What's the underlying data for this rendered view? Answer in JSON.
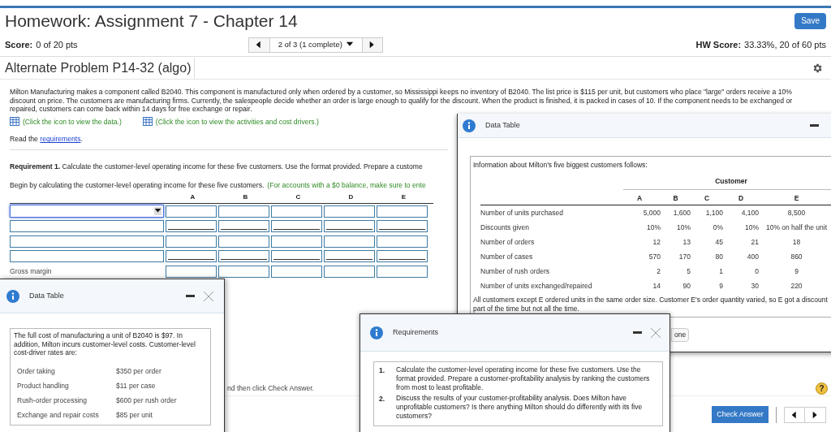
{
  "header": {
    "title": "Homework: Assignment 7 - Chapter 14",
    "save_button": "Save"
  },
  "score_bar": {
    "score_label": "Score:",
    "score_value": "0 of 20 pts",
    "nav_position": "2 of 3 (1 complete)",
    "hw_score_label": "HW Score:",
    "hw_score_value": "33.33%, 20 of 60 pts"
  },
  "problem": {
    "title": "Alternate Problem P14-32 (algo)",
    "description": "Milton Manufacturing makes a component called B2040. This component is manufactured only when ordered by a customer, so Mississippi keeps no inventory of B2040. The list price is $115 per unit, but customers who place \"large\" orders receive a 10% discount on price. The customers are manufacturing firms. Currently, the salespeople decide whether an order is large enough to qualify for the discount. When the product is finished, it is packed in cases of 10. If the component needs to be exchanged or repaired, customers can come back within 14 days for free exchange or repair.",
    "links": [
      "(Click the icon to view the data.)",
      "(Click the icon to view the activities and cost drivers.)"
    ],
    "read_prefix": "Read the",
    "read_link": "requirements",
    "read_suffix": ".",
    "requirement_label": "Requirement 1.",
    "requirement_text": "Calculate the customer-level operating income for these five customers. Use the format provided. Prepare a custome",
    "instruction": "Begin by calculating the customer-level operating income for these five customers.",
    "instruction_hint": "(For accounts with a $0 balance, make sure to ente"
  },
  "answer_grid": {
    "columns": [
      "A",
      "B",
      "C",
      "D",
      "E"
    ],
    "rows": [
      {
        "kind": "select",
        "focused": true,
        "total_line": false
      },
      {
        "kind": "input",
        "focused": false,
        "total_line": true
      },
      {
        "kind": "input",
        "focused": false,
        "total_line": false
      },
      {
        "kind": "input",
        "focused": false,
        "total_line": true
      },
      {
        "kind": "label",
        "label": "Gross margin",
        "total_line": false
      }
    ]
  },
  "footer": {
    "hint": "nd then click Check Answer.",
    "help": "?",
    "check_answer": "Check Answer"
  },
  "customer_dialog": {
    "title": "Data Table",
    "intro": "Information about Milton's five biggest customers follows:",
    "group_header": "Customer",
    "columns": [
      "A",
      "B",
      "C",
      "D",
      "E"
    ],
    "rows": [
      {
        "label": "Number of units purchased",
        "values": [
          "5,000",
          "1,600",
          "1,100",
          "4,100",
          "8,500"
        ]
      },
      {
        "label": "Discounts given",
        "values": [
          "10%",
          "10%",
          "0%",
          "10%",
          "10% on half the unit"
        ]
      },
      {
        "label": "Number of orders",
        "values": [
          "12",
          "13",
          "45",
          "21",
          "18"
        ]
      },
      {
        "label": "Number of cases",
        "values": [
          "570",
          "170",
          "80",
          "400",
          "860"
        ]
      },
      {
        "label": "Number of rush orders",
        "values": [
          "2",
          "5",
          "1",
          "0",
          "9"
        ]
      },
      {
        "label": "Number of units exchanged/repaired",
        "values": [
          "14",
          "90",
          "9",
          "30",
          "220"
        ]
      }
    ],
    "note": "All customers except E ordered units in the same order size. Customer E's order quantity varied, so E got a discount part of the time but not all the time.",
    "done_button": "one"
  },
  "cost_dialog": {
    "title": "Data Table",
    "intro": "The full cost of manufacturing a unit of B2040 is $97. In addition, Milton incurs customer-level costs. Customer-level cost-driver rates are:",
    "rates": [
      {
        "activity": "Order taking",
        "rate": "$350 per order"
      },
      {
        "activity": "Product handling",
        "rate": "$11 per case"
      },
      {
        "activity": "Rush-order processing",
        "rate": "$600 per rush order"
      },
      {
        "activity": "Exchange and repair costs",
        "rate": "$85 per unit"
      }
    ]
  },
  "requirements_dialog": {
    "title": "Requirements",
    "items": [
      {
        "number": "1.",
        "text": "Calculate the customer-level operating income for these five customers. Use the format provided. Prepare a customer-profitability analysis by ranking the customers from most to least profitable."
      },
      {
        "number": "2.",
        "text": "Discuss the results of your customer-profitability analysis. Does Milton have unprofitable customers? Is there anything Milton should do differently with its five customers?"
      }
    ]
  }
}
